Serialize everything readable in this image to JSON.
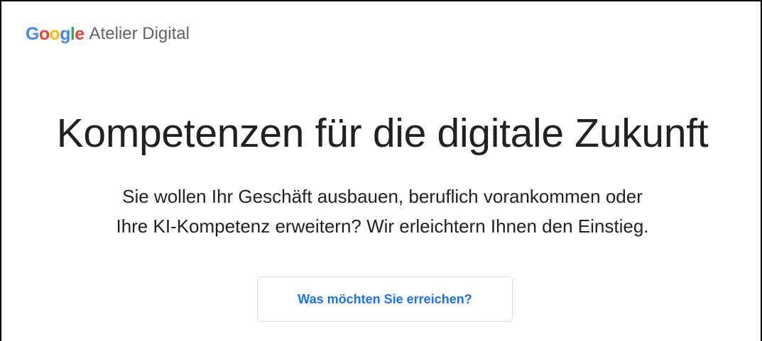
{
  "header": {
    "logo": {
      "letters": [
        {
          "char": "G",
          "color": "#4285F4"
        },
        {
          "char": "o",
          "color": "#EA4335"
        },
        {
          "char": "o",
          "color": "#FBBC05"
        },
        {
          "char": "g",
          "color": "#4285F4"
        },
        {
          "char": "l",
          "color": "#34A853"
        },
        {
          "char": "e",
          "color": "#EA4335"
        }
      ],
      "product": "Atelier Digital"
    }
  },
  "hero": {
    "title": "Kompetenzen für die digitale Zukunft",
    "subtitle_line1": "Sie wollen Ihr Geschäft ausbauen, beruflich vorankommen oder",
    "subtitle_line2": "Ihre KI-Kompetenz erweitern? Wir erleichtern Ihnen den Einstieg.",
    "cta_label": "Was möchten Sie erreichen?"
  },
  "colors": {
    "accent": "#1a73e8",
    "text": "#202124",
    "muted": "#5f6368",
    "border": "#dadce0"
  }
}
